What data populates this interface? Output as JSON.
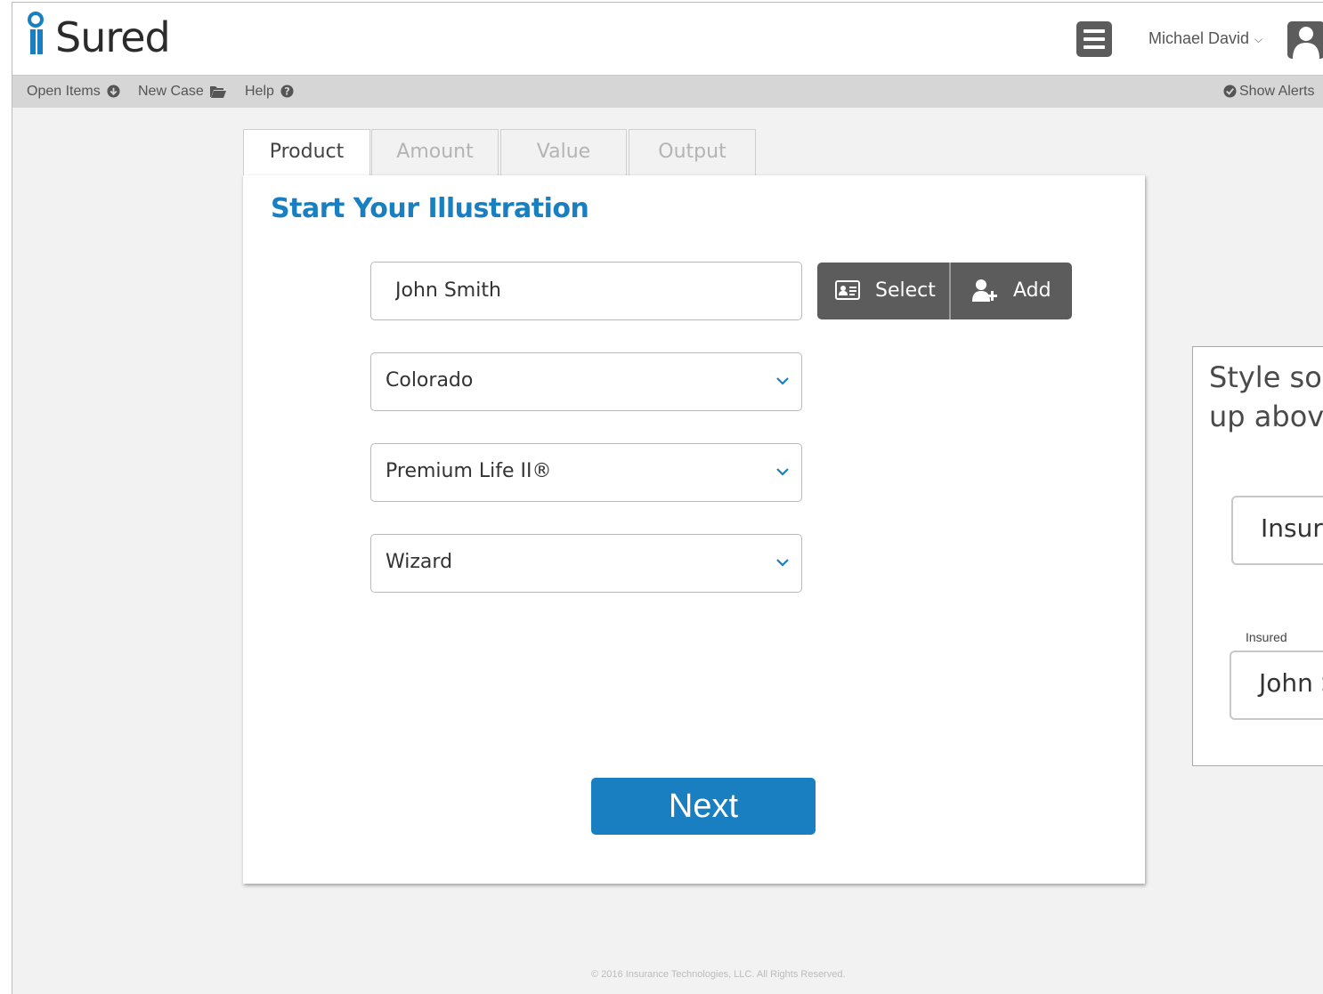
{
  "app": {
    "logo_text": "Sured",
    "user_name": "Michael David"
  },
  "nav": {
    "open_items": "Open Items",
    "new_case": "New Case",
    "help": "Help",
    "show_alerts": "Show Alerts"
  },
  "tabs": [
    {
      "label": "Product",
      "active": true
    },
    {
      "label": "Amount",
      "active": false
    },
    {
      "label": "Value",
      "active": false
    },
    {
      "label": "Output",
      "active": false
    }
  ],
  "form": {
    "title": "Start Your Illustration",
    "client_name": "John Smith",
    "select_label": "Select",
    "add_label": "Add",
    "state": "Colorado",
    "product": "Premium Life II®",
    "mode": "Wizard",
    "next_label": "Next"
  },
  "footer": {
    "copyright": "© 2016 Insurance Technologies, LLC. All Rights Reserved."
  },
  "note": {
    "text": "Style so t\nup above",
    "field1": "Insure",
    "field2_label": "Insured",
    "field2_value": "John S"
  },
  "colors": {
    "accent": "#1a7fc0",
    "dark_button": "#5c5c5c",
    "background": "#f2f2f2"
  }
}
